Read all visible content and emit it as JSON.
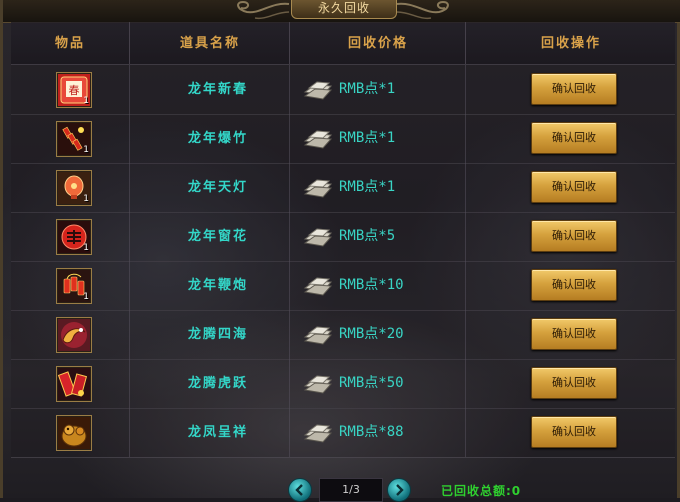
{
  "title": "永久回收",
  "headers": {
    "item": "物品",
    "name": "道具名称",
    "price": "回收价格",
    "op": "回收操作"
  },
  "rows": [
    {
      "name": "龙年新春",
      "price": "RMB点*1",
      "qty": "1",
      "icon": "spring-couplet-icon",
      "button": "确认回收"
    },
    {
      "name": "龙年爆竹",
      "price": "RMB点*1",
      "qty": "1",
      "icon": "firecracker-icon",
      "button": "确认回收"
    },
    {
      "name": "龙年天灯",
      "price": "RMB点*1",
      "qty": "1",
      "icon": "sky-lantern-icon",
      "button": "确认回收"
    },
    {
      "name": "龙年窗花",
      "price": "RMB点*5",
      "qty": "1",
      "icon": "window-flower-icon",
      "button": "确认回收"
    },
    {
      "name": "龙年鞭炮",
      "price": "RMB点*10",
      "qty": "1",
      "icon": "firecrackers-string-icon",
      "button": "确认回收"
    },
    {
      "name": "龙腾四海",
      "price": "RMB点*20",
      "qty": "",
      "icon": "dragon-sea-icon",
      "button": "确认回收"
    },
    {
      "name": "龙腾虎跃",
      "price": "RMB点*50",
      "qty": "",
      "icon": "dragon-tiger-icon",
      "button": "确认回收"
    },
    {
      "name": "龙凤呈祥",
      "price": "RMB点*88",
      "qty": "",
      "icon": "dragon-phoenix-icon",
      "button": "确认回收"
    }
  ],
  "pager": {
    "page": "1/3",
    "prev_icon": "chevron-left-icon",
    "next_icon": "chevron-right-icon"
  },
  "footer": {
    "recycled_total": "已回收总额:0"
  },
  "colors": {
    "accent": "#d9a24a",
    "item_name": "#33d6c8",
    "button": "#d5a13d",
    "total": "#2fd02f"
  }
}
